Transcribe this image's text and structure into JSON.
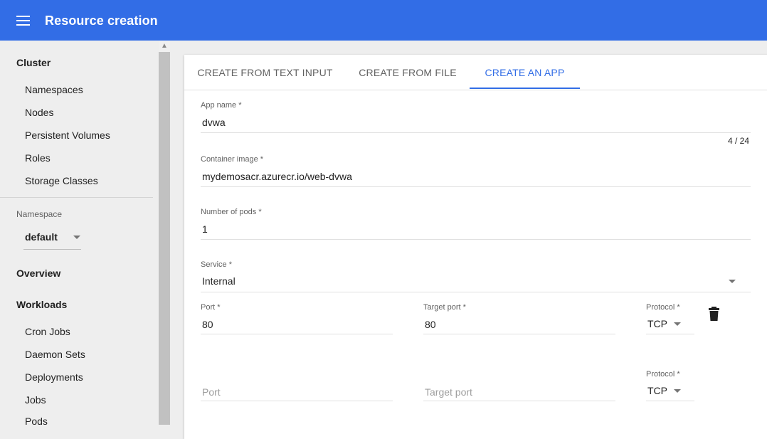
{
  "header": {
    "title": "Resource creation",
    "menu_icon": "menu-icon"
  },
  "sidebar": {
    "cluster": {
      "label": "Cluster",
      "items": [
        "Namespaces",
        "Nodes",
        "Persistent Volumes",
        "Roles",
        "Storage Classes"
      ]
    },
    "namespace": {
      "label": "Namespace",
      "value": "default"
    },
    "overview": "Overview",
    "workloads": {
      "label": "Workloads",
      "items": [
        "Cron Jobs",
        "Daemon Sets",
        "Deployments",
        "Jobs",
        "Pods"
      ]
    }
  },
  "tabs": [
    {
      "label": "CREATE FROM TEXT INPUT",
      "active": false
    },
    {
      "label": "CREATE FROM FILE",
      "active": false
    },
    {
      "label": "CREATE AN APP",
      "active": true
    }
  ],
  "form": {
    "app_name": {
      "label": "App name",
      "required": "*",
      "value": "dvwa",
      "counter": "4 / 24"
    },
    "container_image": {
      "label": "Container image",
      "required": "*",
      "value": "mydemosacr.azurecr.io/web-dvwa"
    },
    "pods": {
      "label": "Number of pods",
      "required": "*",
      "value": "1"
    },
    "service": {
      "label": "Service",
      "required": "*",
      "value": "Internal"
    },
    "port_row_1": {
      "port_label": "Port",
      "port_value": "80",
      "target_label": "Target port",
      "target_value": "80",
      "protocol_label": "Protocol",
      "protocol_value": "TCP"
    },
    "port_row_2": {
      "port_placeholder": "Port",
      "target_placeholder": "Target port",
      "protocol_label": "Protocol",
      "protocol_value": "TCP"
    },
    "required_mark": "*"
  },
  "colors": {
    "primary": "#326de6",
    "background": "#eeeeee",
    "card": "#ffffff"
  }
}
